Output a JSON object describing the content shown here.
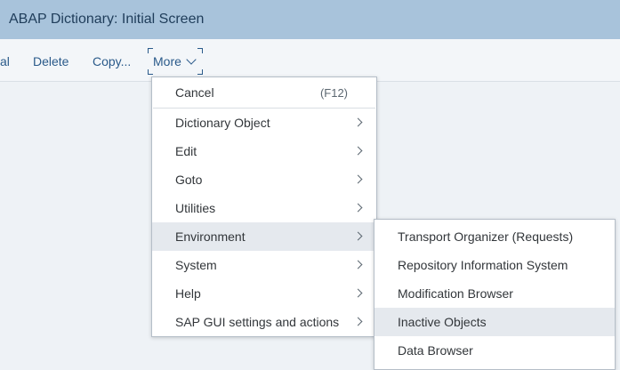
{
  "window": {
    "title": "ABAP Dictionary: Initial Screen"
  },
  "toolbar": {
    "partial_label": "al",
    "delete_label": "Delete",
    "copy_label": "Copy...",
    "more_label": "More"
  },
  "more_menu": {
    "cancel": {
      "label": "Cancel",
      "shortcut": "(F12)"
    },
    "items": [
      {
        "label": "Dictionary Object"
      },
      {
        "label": "Edit"
      },
      {
        "label": "Goto"
      },
      {
        "label": "Utilities"
      },
      {
        "label": "Environment"
      },
      {
        "label": "System"
      },
      {
        "label": "Help"
      },
      {
        "label": "SAP GUI settings and actions"
      }
    ]
  },
  "environment_submenu": {
    "items": [
      {
        "label": "Transport Organizer (Requests)"
      },
      {
        "label": "Repository Information System"
      },
      {
        "label": "Modification Browser"
      },
      {
        "label": "Inactive Objects"
      },
      {
        "label": "Data Browser"
      }
    ]
  },
  "icons": {
    "more_dropdown": "chevron-down-icon",
    "submenu_arrow": "chevron-right-icon"
  },
  "colors": {
    "title_bar": "#a8c3db",
    "link_text": "#2a5a8a",
    "highlight": "#e5e9ee"
  }
}
